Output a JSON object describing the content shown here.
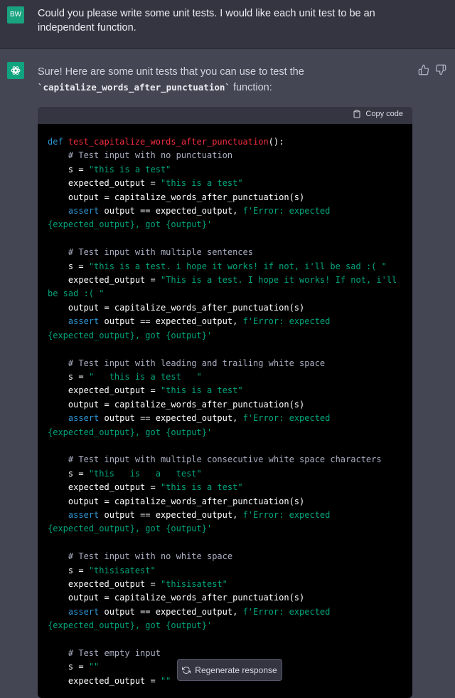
{
  "user": {
    "avatar_initials": "BW",
    "message": "Could you please write some unit tests. I would like each unit test to be an independent function."
  },
  "assistant": {
    "intro_text": "Sure! Here are some unit tests that you can use to test the",
    "intro_code": "`capitalize_words_after_punctuation`",
    "intro_suffix": " function:"
  },
  "code_block": {
    "copy_label": "Copy code",
    "lines": [
      [
        [
          "kw",
          "def "
        ],
        [
          "fn",
          "test_capitalize_words_after_punctuation"
        ],
        [
          "tx",
          "():"
        ]
      ],
      [
        [
          "tx",
          "    "
        ],
        [
          "cm",
          "# Test input with no punctuation"
        ]
      ],
      [
        [
          "tx",
          "    s = "
        ],
        [
          "st",
          "\"this is a test\""
        ]
      ],
      [
        [
          "tx",
          "    expected_output = "
        ],
        [
          "st",
          "\"this is a test\""
        ]
      ],
      [
        [
          "tx",
          "    output = capitalize_words_after_punctuation(s)"
        ]
      ],
      [
        [
          "tx",
          "    "
        ],
        [
          "kw",
          "assert"
        ],
        [
          "tx",
          " output == expected_output, "
        ],
        [
          "st",
          "f'Error: expected {expected_output}, got {output}'"
        ]
      ],
      [
        [
          "tx",
          ""
        ]
      ],
      [
        [
          "tx",
          "    "
        ],
        [
          "cm",
          "# Test input with multiple sentences"
        ]
      ],
      [
        [
          "tx",
          "    s = "
        ],
        [
          "st",
          "\"this is a test. i hope it works! if not, i'll be sad :( \""
        ]
      ],
      [
        [
          "tx",
          "    expected_output = "
        ],
        [
          "st",
          "\"This is a test. I hope it works! If not, i'll be sad :( \""
        ]
      ],
      [
        [
          "tx",
          "    output = capitalize_words_after_punctuation(s)"
        ]
      ],
      [
        [
          "tx",
          "    "
        ],
        [
          "kw",
          "assert"
        ],
        [
          "tx",
          " output == expected_output, "
        ],
        [
          "st",
          "f'Error: expected {expected_output}, got {output}'"
        ]
      ],
      [
        [
          "tx",
          ""
        ]
      ],
      [
        [
          "tx",
          "    "
        ],
        [
          "cm",
          "# Test input with leading and trailing white space"
        ]
      ],
      [
        [
          "tx",
          "    s = "
        ],
        [
          "st",
          "\"   this is a test   \""
        ]
      ],
      [
        [
          "tx",
          "    expected_output = "
        ],
        [
          "st",
          "\"this is a test\""
        ]
      ],
      [
        [
          "tx",
          "    output = capitalize_words_after_punctuation(s)"
        ]
      ],
      [
        [
          "tx",
          "    "
        ],
        [
          "kw",
          "assert"
        ],
        [
          "tx",
          " output == expected_output, "
        ],
        [
          "st",
          "f'Error: expected {expected_output}, got {output}'"
        ]
      ],
      [
        [
          "tx",
          ""
        ]
      ],
      [
        [
          "tx",
          "    "
        ],
        [
          "cm",
          "# Test input with multiple consecutive white space characters"
        ]
      ],
      [
        [
          "tx",
          "    s = "
        ],
        [
          "st",
          "\"this   is   a   test\""
        ]
      ],
      [
        [
          "tx",
          "    expected_output = "
        ],
        [
          "st",
          "\"this is a test\""
        ]
      ],
      [
        [
          "tx",
          "    output = capitalize_words_after_punctuation(s)"
        ]
      ],
      [
        [
          "tx",
          "    "
        ],
        [
          "kw",
          "assert"
        ],
        [
          "tx",
          " output == expected_output, "
        ],
        [
          "st",
          "f'Error: expected {expected_output}, got {output}'"
        ]
      ],
      [
        [
          "tx",
          ""
        ]
      ],
      [
        [
          "tx",
          "    "
        ],
        [
          "cm",
          "# Test input with no white space"
        ]
      ],
      [
        [
          "tx",
          "    s = "
        ],
        [
          "st",
          "\"thisisatest\""
        ]
      ],
      [
        [
          "tx",
          "    expected_output = "
        ],
        [
          "st",
          "\"thisisatest\""
        ]
      ],
      [
        [
          "tx",
          "    output = capitalize_words_after_punctuation(s)"
        ]
      ],
      [
        [
          "tx",
          "    "
        ],
        [
          "kw",
          "assert"
        ],
        [
          "tx",
          " output == expected_output, "
        ],
        [
          "st",
          "f'Error: expected {expected_output}, got {output}'"
        ]
      ],
      [
        [
          "tx",
          ""
        ]
      ],
      [
        [
          "tx",
          "    "
        ],
        [
          "cm",
          "# Test empty input"
        ]
      ],
      [
        [
          "tx",
          "    s = "
        ],
        [
          "st",
          "\"\""
        ]
      ],
      [
        [
          "tx",
          "    expected_output = "
        ],
        [
          "st",
          "\"\""
        ]
      ]
    ]
  },
  "regenerate_label": "Regenerate response"
}
